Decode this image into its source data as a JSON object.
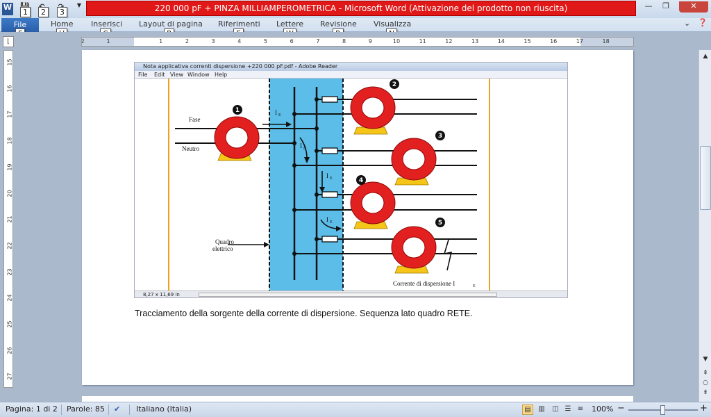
{
  "titlebar": {
    "title": "220 000 pF + PINZA MILLIAMPEROMETRICA  -  Microsoft Word (Attivazione del prodotto non riuscita)",
    "app_icon": "W",
    "qat_keytips": [
      "1",
      "2",
      "3"
    ],
    "controls": {
      "minimize": "—",
      "maximize": "❐",
      "close": "✕"
    }
  },
  "ribbon": {
    "file_label": "File",
    "tabs": [
      {
        "label": "Home",
        "keytip": "H"
      },
      {
        "label": "Inserisci",
        "keytip": "C"
      },
      {
        "label": "Layout di pagina",
        "keytip": "P"
      },
      {
        "label": "Riferimenti",
        "keytip": "E"
      },
      {
        "label": "Lettere",
        "keytip": "W"
      },
      {
        "label": "Revisione",
        "keytip": "R"
      },
      {
        "label": "Visualizza",
        "keytip": "N"
      }
    ],
    "file_keytip": "F"
  },
  "ruler": {
    "h_numbers": [
      "2",
      "1",
      "1",
      "2",
      "3",
      "4",
      "5",
      "6",
      "7",
      "8",
      "9",
      "10",
      "11",
      "12",
      "13",
      "14",
      "15",
      "16",
      "17",
      "18"
    ],
    "v_numbers": [
      "15",
      "16",
      "17",
      "18",
      "19",
      "20",
      "21",
      "22",
      "23",
      "24",
      "25",
      "26",
      "27"
    ]
  },
  "embedded": {
    "title": "Nota applicativa correnti dispersione +220 000 pF.pdf - Adobe Reader",
    "menu": [
      "File",
      "Edit",
      "View",
      "Window",
      "Help"
    ],
    "status": "8,27 x 11,69 in",
    "diagram": {
      "labels": {
        "fase": "Fase",
        "neutro": "Neutro",
        "quadro_1": "Quadro",
        "quadro_2": "elettrico",
        "corrente": "Corrente di dispersione I",
        "corrente_sub": "E",
        "ie": "I",
        "ie_sub": "E"
      },
      "badges": [
        "1",
        "2",
        "3",
        "4",
        "5"
      ],
      "colors": {
        "panel": "#5bbde8",
        "clamp": "#e22020",
        "clamp_jaw": "#f5c518",
        "border": "#f0a020"
      }
    }
  },
  "document": {
    "caption": "Tracciamento della sorgente della corrente di dispersione. Sequenza  lato quadro RETE."
  },
  "status": {
    "page": "Pagina: 1 di 2",
    "words": "Parole: 85",
    "language": "Italiano (Italia)",
    "zoom": "100%",
    "zoom_minus": "−",
    "zoom_plus": "+"
  }
}
